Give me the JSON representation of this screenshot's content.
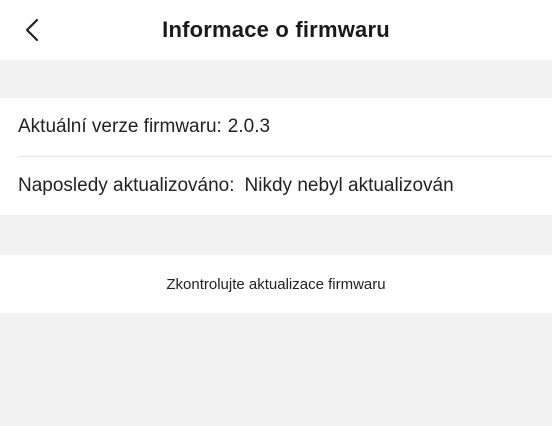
{
  "header": {
    "title": "Informace o firmwaru",
    "back_icon": "chevron-left-icon"
  },
  "firmware": {
    "current_version_label": "Aktuální verze firmwaru:",
    "current_version_value": "2.0.3",
    "last_updated_label": "Naposledy aktualizováno:",
    "last_updated_value": "Nikdy nebyl aktualizován"
  },
  "actions": {
    "check_updates_label": "Zkontrolujte aktualizace firmwaru"
  },
  "colors": {
    "background": "#f2f2f2",
    "surface": "#ffffff",
    "text": "#222222",
    "divider": "#e6e6e6"
  }
}
